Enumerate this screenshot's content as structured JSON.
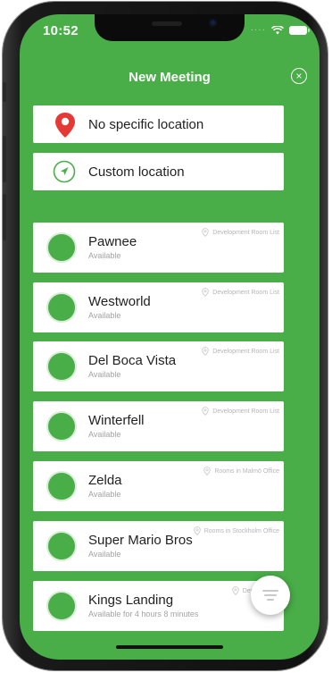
{
  "status_bar": {
    "time": "10:52"
  },
  "header": {
    "title": "New Meeting",
    "close_glyph": "×"
  },
  "locations": [
    {
      "label": "No specific location",
      "icon": "map-pin-icon",
      "color": "#e53935"
    },
    {
      "label": "Custom location",
      "icon": "navigation-arrow-icon",
      "color": "#49ad48"
    }
  ],
  "rooms": [
    {
      "name": "Pawnee",
      "status": "Available",
      "list": "Development Room List"
    },
    {
      "name": "Westworld",
      "status": "Available",
      "list": "Development Room List"
    },
    {
      "name": "Del Boca Vista",
      "status": "Available",
      "list": "Development Room List"
    },
    {
      "name": "Winterfell",
      "status": "Available",
      "list": "Development Room List"
    },
    {
      "name": "Zelda",
      "status": "Available",
      "list": "Rooms in Malmö Office"
    },
    {
      "name": "Super Mario Bros",
      "status": "Available",
      "list": "Rooms in Stockholm Office"
    },
    {
      "name": "Kings Landing",
      "status": "Available for 4 hours 8 minutes",
      "list": "Development"
    }
  ],
  "colors": {
    "accent": "#49ad48",
    "pin": "#e53935"
  },
  "fab": {
    "icon": "filter-icon"
  }
}
